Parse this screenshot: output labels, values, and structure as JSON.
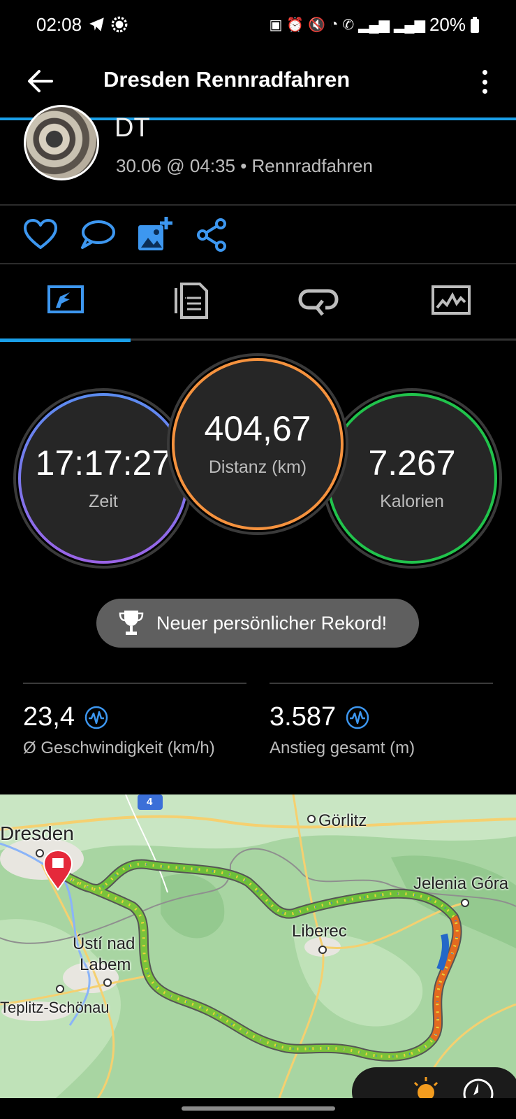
{
  "status_bar": {
    "time": "02:08",
    "battery": "20%"
  },
  "app_bar": {
    "title": "Dresden Rennradfahren"
  },
  "activity": {
    "name": "DT",
    "subtitle": "30.06 @ 04:35 • Rennradfahren"
  },
  "actions": [
    "heart-icon",
    "comment-icon",
    "add-photo-icon",
    "share-icon"
  ],
  "tabs": [
    "overview-tab",
    "details-tab",
    "laps-tab",
    "charts-tab"
  ],
  "active_tab": 0,
  "metrics": {
    "time": {
      "value": "17:17:27",
      "label": "Zeit"
    },
    "distance": {
      "value": "404,67",
      "label": "Distanz (km)"
    },
    "calories": {
      "value": "7.267",
      "label": "Kalorien"
    }
  },
  "record_badge": "Neuer persönlicher Rekord!",
  "stats": {
    "speed": {
      "value": "23,4",
      "label": "Ø Geschwindigkeit (km/h)"
    },
    "ascent": {
      "value": "3.587",
      "label": "Anstieg gesamt (m)"
    }
  },
  "map": {
    "labels": {
      "dresden": "Dresden",
      "goerlitz": "Görlitz",
      "jelenia": "Jelenia Góra",
      "liberec": "Liberec",
      "usti1": "Ústí nad",
      "usti2": "Labem",
      "teplitz": "Teplitz-Schönau",
      "road": "4"
    }
  },
  "colors": {
    "accent": "#1a9fe8",
    "time_ring_start": "#5b8cf0",
    "time_ring_end": "#9a63e6",
    "distance_ring": "#f5923e",
    "calories_ring": "#21c34c"
  }
}
